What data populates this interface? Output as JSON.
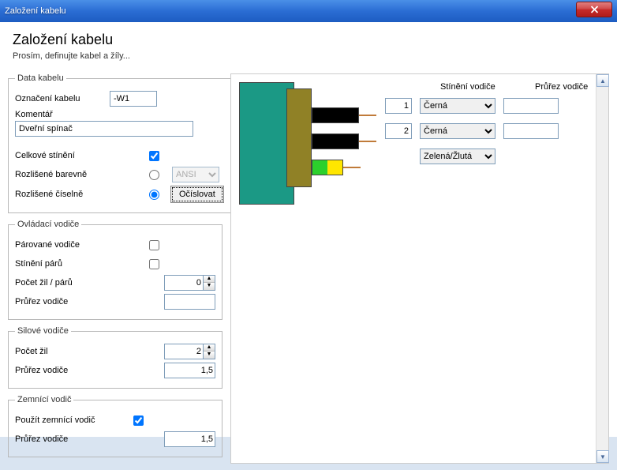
{
  "window": {
    "title": "Založení kabelu"
  },
  "header": {
    "title": "Založení kabelu",
    "subtitle": "Prosím, definujte kabel a žíly..."
  },
  "data_kabelu": {
    "legend": "Data kabelu",
    "oznaceni_label": "Označení kabelu",
    "oznaceni_value": "-W1",
    "komentar_label": "Komentář",
    "komentar_value": "Dveřní spínač",
    "celkove_stineni_label": "Celkové stínění",
    "celkove_stineni_checked": true,
    "rozlisene_barevne_label": "Rozlišené barevně",
    "rozlisene_barevne_selected": false,
    "ansi_select_value": "ANSI",
    "rozlisene_ciselne_label": "Rozlišené číselně",
    "rozlisene_ciselne_selected": true,
    "ocislovat_btn": "Očíslovat"
  },
  "ovladaci": {
    "legend": "Ovládací vodiče",
    "parovane_label": "Párované vodiče",
    "parovane_checked": false,
    "stineni_paru_label": "Stínění párů",
    "stineni_paru_checked": false,
    "pocet_zil_label": "Počet žil / párů",
    "pocet_zil_value": "0",
    "prurez_label": "Průřez vodiče",
    "prurez_value": ""
  },
  "silove": {
    "legend": "Silové vodiče",
    "pocet_zil_label": "Počet žil",
    "pocet_zil_value": "2",
    "prurez_label": "Průřez vodiče",
    "prurez_value": "1,5"
  },
  "zemnici": {
    "legend": "Zemnící vodič",
    "pouzit_label": "Použít zemnící vodič",
    "pouzit_checked": true,
    "prurez_label": "Průřez vodiče",
    "prurez_value": "1,5"
  },
  "preview": {
    "header_stineni": "Stínění vodiče",
    "header_prurez": "Průřez vodiče",
    "rows": [
      {
        "idx": "1",
        "color": "Černá",
        "cs": ""
      },
      {
        "idx": "2",
        "color": "Černá",
        "cs": ""
      },
      {
        "idx": "",
        "color": "Zelená/Žlutá",
        "cs": ""
      }
    ]
  }
}
